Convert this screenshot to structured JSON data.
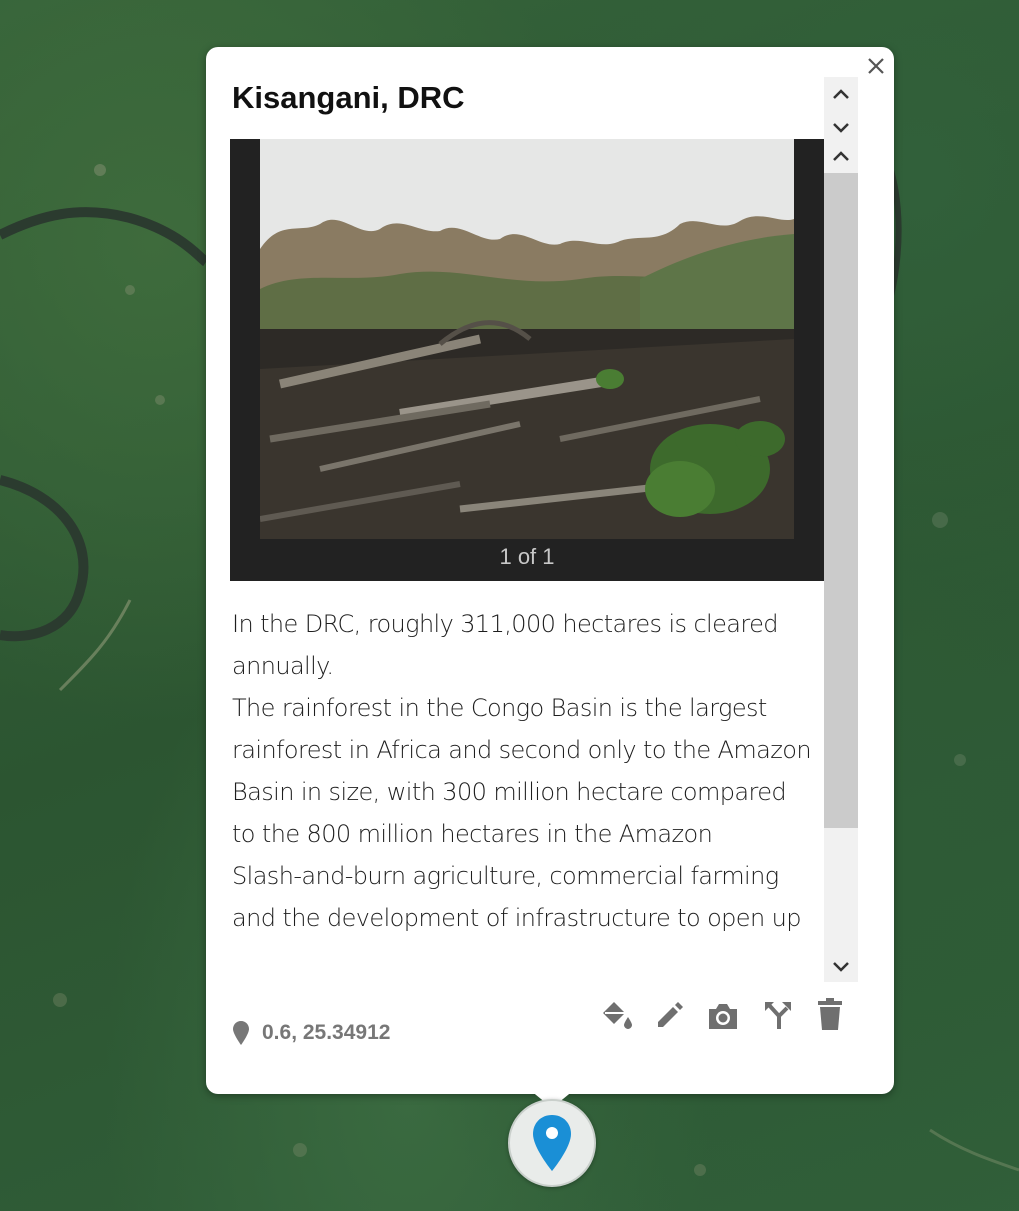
{
  "popup": {
    "title": "Kisangani, DRC",
    "close_icon": "close-icon",
    "gallery": {
      "counter": "1 of 1",
      "image_alt_icon": "photo-deforestation"
    },
    "description": [
      "In the DRC, roughly 311,000 hectares is cleared annually.",
      "The rainforest in the Congo Basin is the largest rainforest in Africa and second only to the Amazon Basin in size, with 300 million hectare compared to the 800 million hectares in the Amazon",
      "Slash-and-burn agriculture, commercial farming and the development of infrastructure to open up"
    ],
    "coordinates": "0.6, 25.34912",
    "toolbar": {
      "icons": [
        "paint-bucket-icon",
        "pencil-icon",
        "camera-icon",
        "branch-icon",
        "trash-icon"
      ]
    },
    "scroll": {
      "icons": [
        "chevron-up-icon",
        "chevron-down-icon",
        "chevron-up-icon",
        "chevron-down-icon"
      ]
    }
  },
  "marker": {
    "icon": "location-pin-icon",
    "color": "#1a8fd6"
  },
  "colors": {
    "toolbar_icon": "#6f6f6f",
    "coords_text": "#777777",
    "popup_bg": "#ffffff"
  }
}
